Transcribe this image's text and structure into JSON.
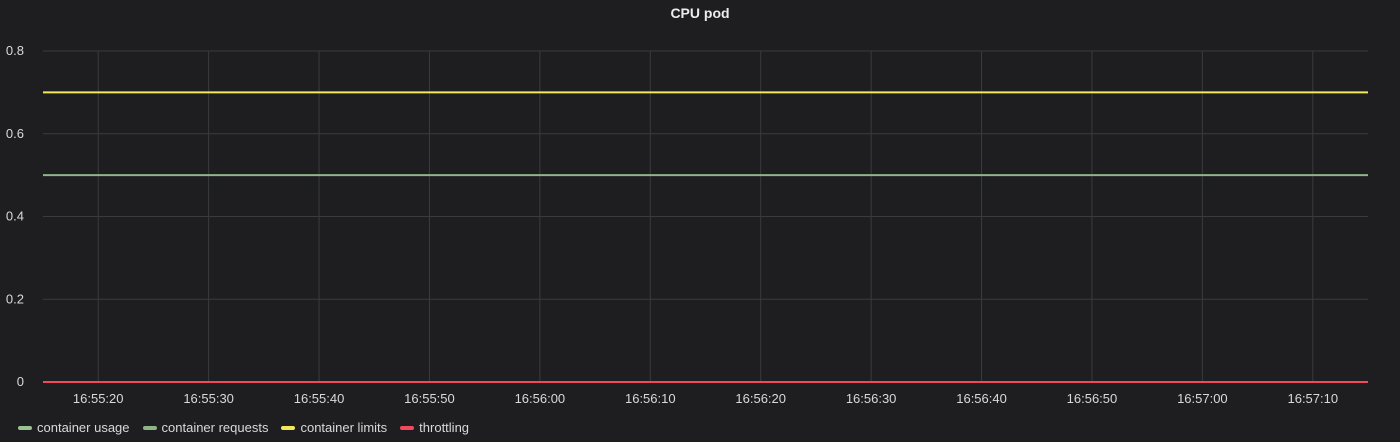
{
  "panel": {
    "title": "CPU pod"
  },
  "chart_data": {
    "type": "line",
    "title": "CPU pod",
    "xlabel": "",
    "ylabel": "",
    "ylim": [
      0,
      0.8
    ],
    "xlim": [
      "16:55:15",
      "16:57:15"
    ],
    "yticks": [
      0,
      0.2,
      0.4,
      0.6,
      0.8
    ],
    "ytick_labels": [
      "0",
      "0.2",
      "0.4",
      "0.6",
      "0.8"
    ],
    "xticks": [
      "16:55:20",
      "16:55:30",
      "16:55:40",
      "16:55:50",
      "16:56:00",
      "16:56:10",
      "16:56:20",
      "16:56:30",
      "16:56:40",
      "16:56:50",
      "16:57:00",
      "16:57:10"
    ],
    "grid": true,
    "legend_position": "bottom-left",
    "x": [
      "16:55:15",
      "16:57:15"
    ],
    "series": [
      {
        "name": "container usage",
        "color": "#96d98d",
        "values": [
          0,
          0
        ]
      },
      {
        "name": "container requests",
        "color": "#8fb486",
        "values": [
          0.5,
          0.5
        ]
      },
      {
        "name": "container limits",
        "color": "#f2e85c",
        "values": [
          0.7,
          0.7
        ]
      },
      {
        "name": "throttling",
        "color": "#f2495c",
        "values": [
          0,
          0
        ]
      }
    ]
  },
  "legend": {
    "items": [
      {
        "label": "container usage",
        "color": "#9cbf93"
      },
      {
        "label": "container requests",
        "color": "#8fb486"
      },
      {
        "label": "container limits",
        "color": "#f2e85c"
      },
      {
        "label": "throttling",
        "color": "#f2495c"
      }
    ]
  }
}
